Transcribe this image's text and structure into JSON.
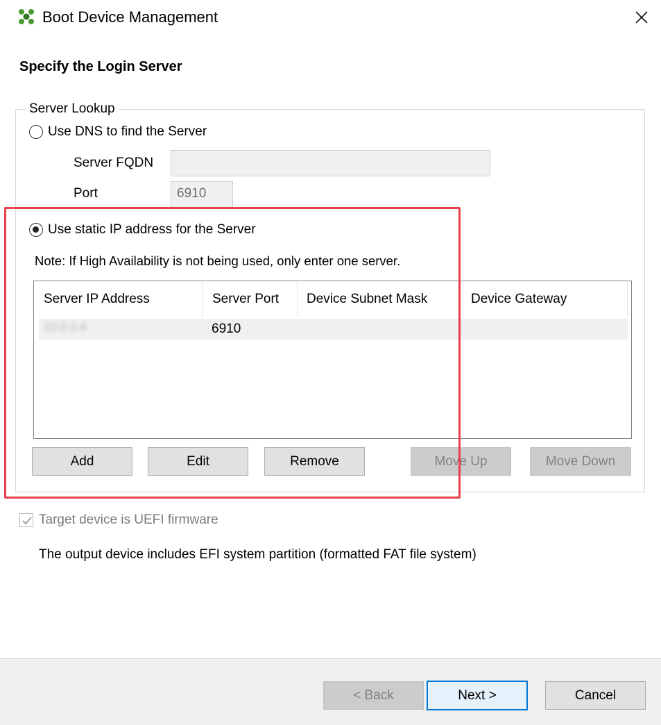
{
  "window": {
    "title": "Boot Device Management",
    "icon": "citrix-app-icon",
    "accent_color": "#3c8a2e"
  },
  "page": {
    "heading": "Specify the Login Server"
  },
  "server_lookup": {
    "legend": "Server Lookup",
    "dns_option": {
      "label": "Use DNS to find the Server",
      "selected": false
    },
    "fqdn": {
      "label": "Server FQDN",
      "value": ""
    },
    "port": {
      "label": "Port",
      "value": "6910"
    },
    "static_option": {
      "label": "Use static IP address for the Server",
      "selected": true
    },
    "note": "Note: If High Availability is not being used, only enter one server.",
    "table": {
      "columns": [
        "Server IP Address",
        "Server Port",
        "Device Subnet Mask",
        "Device Gateway"
      ],
      "rows": [
        {
          "ip": "10.0.3.4",
          "port": "6910",
          "mask": "",
          "gateway": ""
        }
      ]
    },
    "buttons": {
      "add": "Add",
      "edit": "Edit",
      "remove": "Remove",
      "move_up": "Move Up",
      "move_down": "Move Down"
    }
  },
  "uefi": {
    "label": "Target device is UEFI firmware",
    "checked": true,
    "enabled": false,
    "description": "The output device includes EFI system partition (formatted FAT file system)"
  },
  "footer": {
    "back": "< Back",
    "next": "Next >",
    "cancel": "Cancel"
  },
  "colors": {
    "highlight": "#e8404a",
    "default_button_border": "#0078d7",
    "footer_background": "#f0f0f0"
  }
}
